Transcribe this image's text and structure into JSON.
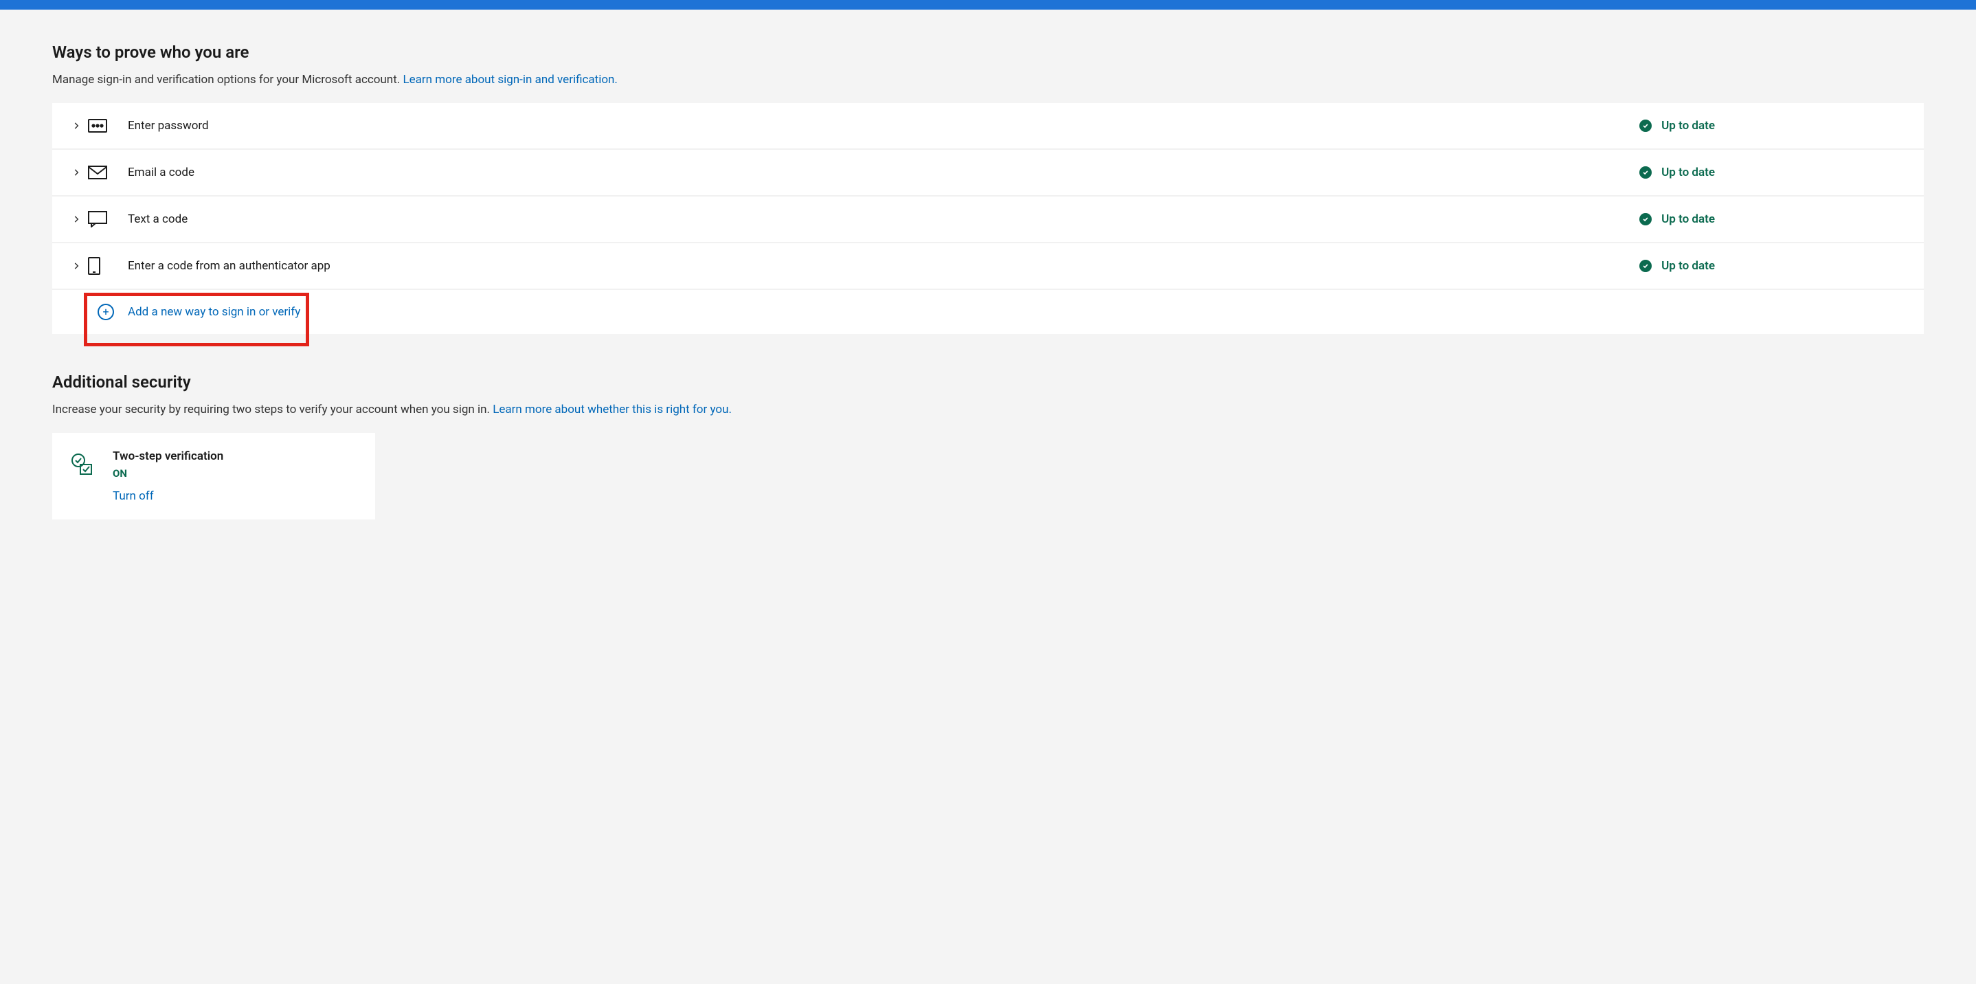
{
  "colors": {
    "accent": "#0067b8",
    "banner": "#1e73d6",
    "success": "#0b6a4f",
    "highlight": "#e2231a"
  },
  "section1": {
    "title": "Ways to prove who you are",
    "subtitle_prefix": "Manage sign-in and verification options for your Microsoft account. ",
    "subtitle_link": "Learn more about sign-in and verification."
  },
  "methods": [
    {
      "icon": "password-icon",
      "label": "Enter password",
      "status": "Up to date"
    },
    {
      "icon": "email-icon",
      "label": "Email a code",
      "status": "Up to date"
    },
    {
      "icon": "sms-icon",
      "label": "Text a code",
      "status": "Up to date"
    },
    {
      "icon": "phone-icon",
      "label": "Enter a code from an authenticator app",
      "status": "Up to date"
    }
  ],
  "add_row": {
    "label": "Add a new way to sign in or verify"
  },
  "section2": {
    "title": "Additional security",
    "subtitle_prefix": "Increase your security by requiring two steps to verify your account when you sign in. ",
    "subtitle_link": "Learn more about whether this is right for you."
  },
  "twostep": {
    "title": "Two-step verification",
    "status": "ON",
    "action": "Turn off"
  }
}
